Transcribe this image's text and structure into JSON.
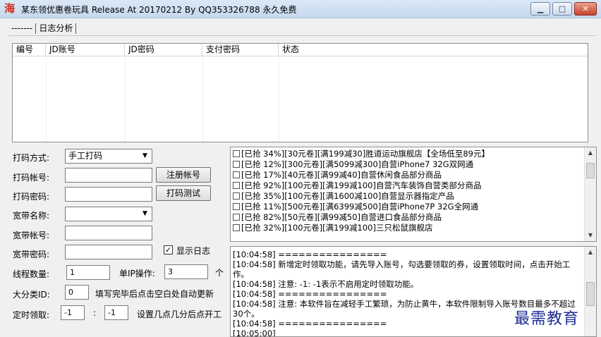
{
  "window": {
    "title": "某东领优惠卷玩具 Release At 20170212 By QQ353326788 永久免费",
    "icon_char": "海",
    "min_symbol": "▁",
    "max_symbol": "□",
    "close_symbol": "✕"
  },
  "tabs": [
    "-------",
    "日志分析"
  ],
  "accounts_table": {
    "columns": [
      "编号",
      "JD账号",
      "JD密码",
      "支付密码",
      "状态"
    ]
  },
  "form": {
    "captcha_mode_label": "打码方式:",
    "captcha_mode_value": "手工打码",
    "captcha_account_label": "打码帐号:",
    "captcha_password_label": "打码密码:",
    "register_button": "注册帐号",
    "test_button": "打码测试",
    "broadband_name_label": "宽带名称:",
    "broadband_account_label": "宽带帐号:",
    "broadband_password_label": "宽带密码:",
    "show_log_label": "显示日志",
    "show_log_checked": "✓",
    "threads_label": "线程数量:",
    "threads_value": "1",
    "per_ip_label": "单IP操作:",
    "per_ip_value": "3",
    "per_ip_unit": "个",
    "category_label": "大分类ID:",
    "category_value": "0",
    "category_hint": "填写完毕后点击空白处自动更新",
    "timer_label": "定时领取:",
    "timer_hour": "-1",
    "timer_sep": ":",
    "timer_minute": "-1",
    "timer_hint": "设置几点几分后点开工"
  },
  "coupons": [
    "[已抢 34%][30元卷][满199减30]胜道运动旗舰店【全场低至89元】",
    "[已抢 12%][300元卷][满5099减300]自营iPhone7 32G双网通",
    "[已抢 17%][40元卷][满99减40]自营休闲食品部分商品",
    "[已抢 92%][100元卷][满199减100]自营汽车装饰自营类部分商品",
    "[已抢 35%][100元卷][满1600减100]自营显示器指定产品",
    "[已抢 11%][500元卷][满6399减500]自营iPhone7P 32G全网通",
    "[已抢 82%][50元卷][满99减50]自营进口食品部分商品",
    "[已抢 32%][100元卷][满199减100]三只松鼠旗舰店"
  ],
  "log": [
    "[10:04:58] ================",
    "[10:04:58] 新增定时领取功能，请先导入账号，勾选要领取的券，设置领取时间，点击开始工作。",
    "[10:04:58] 注意: -1: -1表示不启用定时领取功能。",
    "[10:04:58] ================",
    "[10:04:58] 注意: 本软件旨在减轻手工繁琐，为防止黄牛，本软件限制导入账号数目最多不超过30个。",
    "[10:04:58] ================",
    "[10:05:00]"
  ],
  "watermark": "最需教育"
}
